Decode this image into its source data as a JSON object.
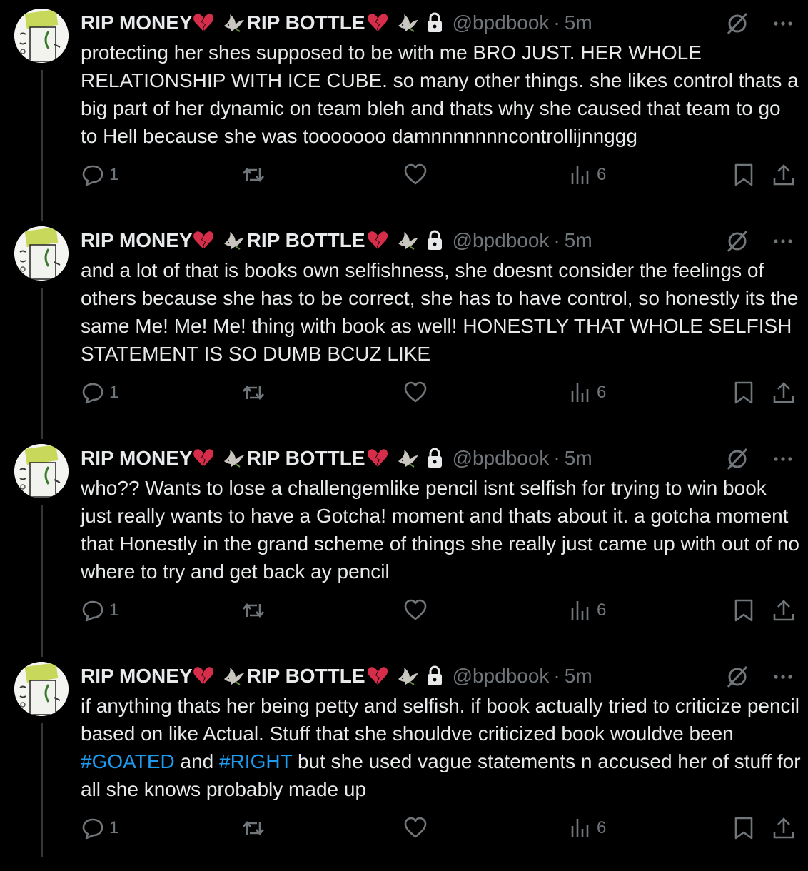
{
  "colors": {
    "background": "#000000",
    "text": "#e7e9ea",
    "secondary": "#71767b",
    "hashtag": "#1d9bf0",
    "heart_emoji": "#d62d4b",
    "dove_emoji": "#c9c6c0",
    "thread_line": "#333639"
  },
  "icons": [
    "broken-heart-emoji",
    "dove-emoji",
    "lock-icon",
    "grok-icon",
    "more-icon",
    "reply-icon",
    "retweet-icon",
    "like-icon",
    "views-icon",
    "bookmark-icon",
    "share-icon"
  ],
  "tweets": [
    {
      "name_part1": "RIP MONEY",
      "name_part2": "RIP BOTTLE",
      "handle": "@bpdbook",
      "separator": "·",
      "time": "5m",
      "text": "protecting her shes supposed to be with me BRO JUST. HER WHOLE RELATIONSHIP WITH ICE CUBE. so many other things. she likes control thats a big part of her dynamic on team bleh and thats why she caused that team to go to Hell because she was tooooooo damnnnnnnncontrollijnnggg",
      "replies": "1",
      "views": "6"
    },
    {
      "name_part1": "RIP MONEY",
      "name_part2": "RIP BOTTLE",
      "handle": "@bpdbook",
      "separator": "·",
      "time": "5m",
      "text": "and a lot of that is books own selfishness, she doesnt consider the feelings of others because she has to be correct, she has to have control, so honestly its the same Me! Me! Me! thing with book as well! HONESTLY THAT WHOLE SELFISH STATEMENT IS SO DUMB BCUZ LIKE",
      "replies": "1",
      "views": "6"
    },
    {
      "name_part1": "RIP MONEY",
      "name_part2": "RIP BOTTLE",
      "handle": "@bpdbook",
      "separator": "·",
      "time": "5m",
      "text": "who?? Wants to lose a challengemlike pencil isnt selfish for trying to win book just really wants to have a Gotcha! moment and thats about it. a gotcha moment that Honestly in the grand scheme of things she really just came up with out of no where to try and get back ay pencil",
      "replies": "1",
      "views": "6"
    },
    {
      "name_part1": "RIP MONEY",
      "name_part2": "RIP BOTTLE",
      "handle": "@bpdbook",
      "separator": "·",
      "time": "5m",
      "text_before": "if anything thats her being petty and selfish. if book actually tried to criticize pencil based on like Actual. Stuff that she shouldve criticized book wouldve been ",
      "hashtag1": "#GOATED",
      "text_middle": " and ",
      "hashtag2": "#RIGHT",
      "text_after": " but she used vague statements n accused her of stuff for all she knows probably made up",
      "replies": "1",
      "views": "6"
    }
  ]
}
